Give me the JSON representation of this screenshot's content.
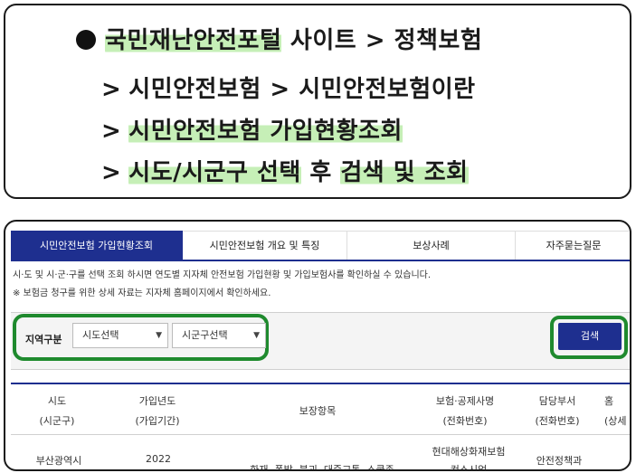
{
  "instructions": {
    "bullet": "●",
    "line1": {
      "highlight": "국민재난안전포털",
      "rest": " 사이트 > 정책보험"
    },
    "line2": {
      "arrow": ">",
      "text": "시민안전보험 > 시민안전보험이란"
    },
    "line3": {
      "arrow": ">",
      "highlight": "시민안전보험 가입현황조회"
    },
    "line4": {
      "arrow": ">",
      "highlight1": "시도/시군구 선택",
      "mid": " 후 ",
      "highlight2": "검색 및 조회"
    }
  },
  "tabs": [
    "시민안전보험 가입현황조회",
    "시민안전보험 개요 및 특징",
    "보상사례",
    "자주묻는질문"
  ],
  "notices": [
    "시·도 및 시·군·구를 선택 조회 하시면 연도별 지자체 안전보험 가입현황 및 가입보험사를 확인하실 수 있습니다.",
    "※ 보험금 청구를 위한 상세 자료는 지자체 홈페이지에서 확인하세요."
  ],
  "search": {
    "region_label": "지역구분",
    "sido_select": "시도선택",
    "sigungu_select": "시군구선택",
    "button": "검색"
  },
  "table": {
    "headers": [
      [
        "시도",
        "(시군구)"
      ],
      [
        "가입년도",
        "(가입기간)"
      ],
      [
        "보장항목"
      ],
      [
        "보험·공제사명",
        "(전화번호)"
      ],
      [
        "담당부서",
        "(전화번호)"
      ],
      [
        "홈",
        "(상세"
      ]
    ],
    "rows": [
      {
        "sido": "부산광역시",
        "year": "2022",
        "coverage": "화재, 폭발, 붕괴, 대중교통, 스쿨존",
        "insurer1": "현대해상화재보험",
        "insurer2": "컨소시엄",
        "dept": "안전정책과"
      }
    ]
  },
  "colors": {
    "highlight": "#c6efb7",
    "primary": "#1e2f8f",
    "annotation": "#1f8a2e"
  }
}
